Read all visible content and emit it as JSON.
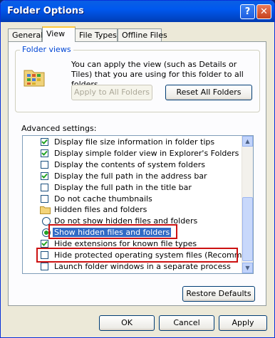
{
  "window": {
    "title": "Folder Options",
    "help": "?",
    "close": "✕"
  },
  "tabs": [
    "General",
    "View",
    "File Types",
    "Offline Files"
  ],
  "folder_views": {
    "title": "Folder views",
    "description": "You can apply the view (such as Details or Tiles) that you are using for this folder to all folders.",
    "apply_label": "Apply to All Folders",
    "reset_label": "Reset All Folders"
  },
  "advanced": {
    "label": "Advanced settings:",
    "items": [
      {
        "type": "checkbox",
        "checked": true,
        "label": "Display file size information in folder tips"
      },
      {
        "type": "checkbox",
        "checked": true,
        "label": "Display simple folder view in Explorer's Folders list"
      },
      {
        "type": "checkbox",
        "checked": false,
        "label": "Display the contents of system folders"
      },
      {
        "type": "checkbox",
        "checked": true,
        "label": "Display the full path in the address bar"
      },
      {
        "type": "checkbox",
        "checked": false,
        "label": "Display the full path in the title bar"
      },
      {
        "type": "checkbox",
        "checked": false,
        "label": "Do not cache thumbnails"
      },
      {
        "type": "folder",
        "label": "Hidden files and folders"
      },
      {
        "type": "radio",
        "checked": false,
        "label": "Do not show hidden files and folders"
      },
      {
        "type": "radio",
        "checked": true,
        "label": "Show hidden files and folders",
        "selected": true
      },
      {
        "type": "checkbox",
        "checked": true,
        "label": "Hide extensions for known file types"
      },
      {
        "type": "checkbox",
        "checked": false,
        "label": "Hide protected operating system files (Recommended)"
      },
      {
        "type": "checkbox",
        "checked": false,
        "label": "Launch folder windows in a separate process"
      }
    ]
  },
  "restore_label": "Restore Defaults",
  "footer": {
    "ok": "OK",
    "cancel": "Cancel",
    "apply": "Apply"
  }
}
